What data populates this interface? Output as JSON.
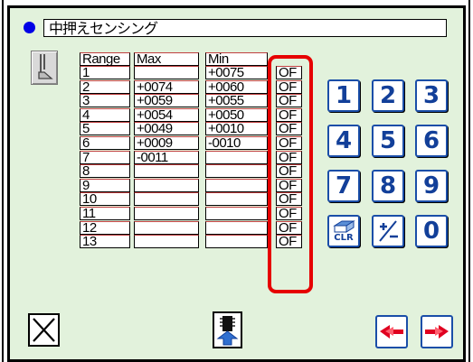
{
  "title": "中押えセンシング",
  "table": {
    "headers": [
      "Range",
      "Max",
      "Min"
    ],
    "rows": [
      {
        "range": "1",
        "max": "",
        "min": "+0075",
        "flag": "OF"
      },
      {
        "range": "2",
        "max": "+0074",
        "min": "+0060",
        "flag": "OF"
      },
      {
        "range": "3",
        "max": "+0059",
        "min": "+0055",
        "flag": "OF"
      },
      {
        "range": "4",
        "max": "+0054",
        "min": "+0050",
        "flag": "OF"
      },
      {
        "range": "5",
        "max": "+0049",
        "min": "+0010",
        "flag": "OF"
      },
      {
        "range": "6",
        "max": "+0009",
        "min": "-0010",
        "flag": "OF"
      },
      {
        "range": "7",
        "max": "-0011",
        "min": "",
        "flag": "OF"
      },
      {
        "range": "8",
        "max": "",
        "min": "",
        "flag": "OF"
      },
      {
        "range": "9",
        "max": "",
        "min": "",
        "flag": "OF"
      },
      {
        "range": "10",
        "max": "",
        "min": "",
        "flag": "OF"
      },
      {
        "range": "11",
        "max": "",
        "min": "",
        "flag": "OF"
      },
      {
        "range": "12",
        "max": "",
        "min": "",
        "flag": "OF"
      },
      {
        "range": "13",
        "max": "",
        "min": "",
        "flag": "OF"
      }
    ]
  },
  "keypad": {
    "row1": [
      "1",
      "2",
      "3"
    ],
    "row2": [
      "4",
      "5",
      "6"
    ],
    "row3": [
      "7",
      "8",
      "9"
    ],
    "clear_label": "CLR",
    "plus_minus_icon": "plus-minus-icon",
    "zero": "0"
  },
  "bottom": {
    "cancel_icon": "close-x-icon",
    "load_icon": "upload-arrow-icon",
    "prev_icon": "double-arrow-left-icon",
    "next_icon": "double-arrow-right-icon"
  },
  "colors": {
    "background": "#e2f2dc",
    "key_border": "#1a4ea8",
    "key_text": "#123f99",
    "highlight": "#e60000",
    "arrow": "#e00020",
    "title_dot": "#0000e6"
  }
}
